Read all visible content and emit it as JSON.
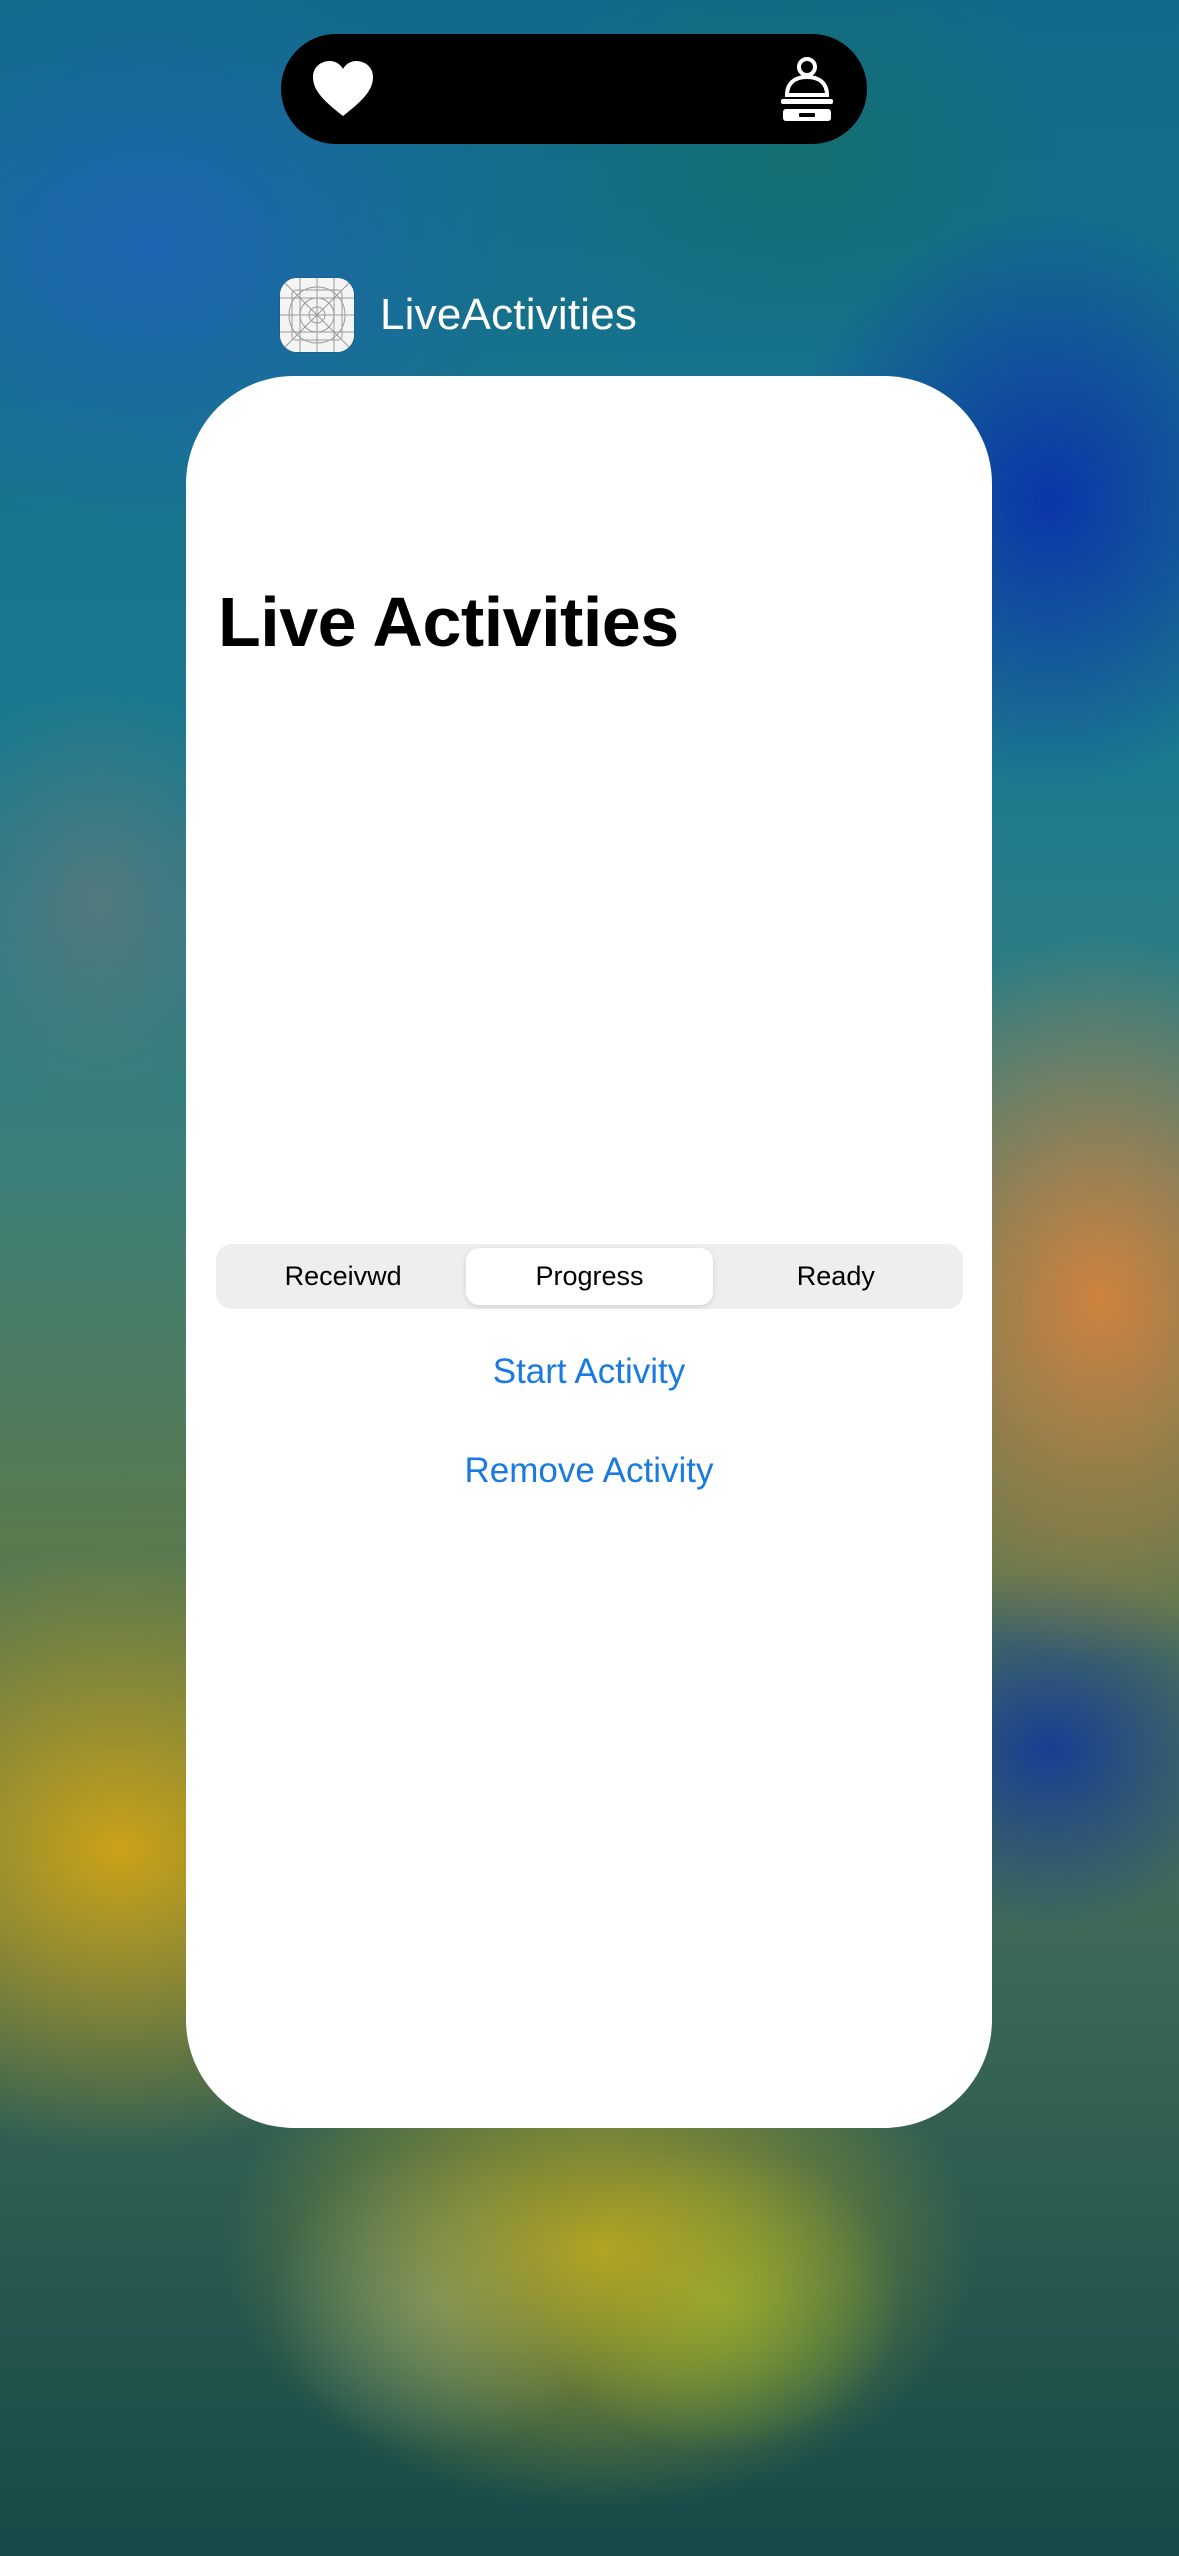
{
  "app": {
    "name": "LiveActivities",
    "icon": "app-placeholder-grid-icon"
  },
  "island": {
    "leading_icon": "heart-icon",
    "trailing_icon": "service-bell-icon"
  },
  "screen": {
    "title": "Live Activities",
    "segments": [
      {
        "label": "Receivwd",
        "selected": false
      },
      {
        "label": "Progress",
        "selected": true
      },
      {
        "label": "Ready",
        "selected": false
      }
    ],
    "start_button": "Start Activity",
    "remove_button": "Remove Activity"
  },
  "colors": {
    "accent": "#1a7ae2",
    "card_background": "#ffffff",
    "island_background": "#000000"
  }
}
